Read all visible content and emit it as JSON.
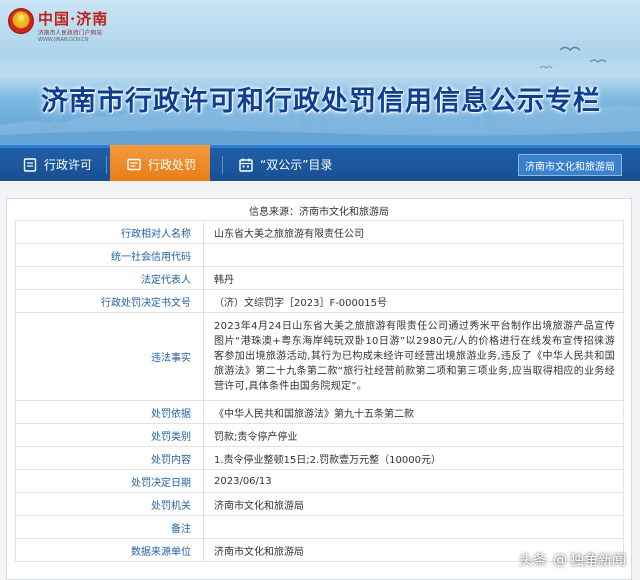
{
  "header": {
    "logo_text": "中国·济南",
    "logo_subtitle": "济南市人民政府门户网站",
    "logo_url": "WWW.JINAN.GOV.CN",
    "banner_title": "济南市行政许可和行政处罚信用信息公示专栏"
  },
  "nav": {
    "items": [
      {
        "label": "行政许可",
        "icon": "document-icon",
        "active": false
      },
      {
        "label": "行政处罚",
        "icon": "gavel-icon",
        "active": true
      },
      {
        "label": "“双公示”目录",
        "icon": "calendar-icon",
        "active": false
      }
    ],
    "department_button": "济南市文化和旅游局",
    "colors": {
      "bar": "#1a4f92",
      "active": "#e67b16"
    }
  },
  "record": {
    "source_line": "信息来源：济南市文化和旅游局",
    "rows": [
      {
        "label": "行政相对人名称",
        "value": "山东省大美之旅旅游有限责任公司"
      },
      {
        "label": "统一社会信用代码",
        "value": ""
      },
      {
        "label": "法定代表人",
        "value": "韩丹"
      },
      {
        "label": "行政处罚决定书文号",
        "value": "（济）文综罚字［2023］F-000015号"
      },
      {
        "label": "违法事实",
        "value": "2023年4月24日山东省大美之旅旅游有限责任公司通过秀米平台制作出境旅游产品宣传图片“港珠澳+粤东海岸纯玩双卧10日游”以2980元/人的价格进行在线发布宣传招徕游客参加出境旅游活动,其行为已构成未经许可经营出境旅游业务,违反了《中华人民共和国旅游法》第二十九条第二款“旅行社经营前款第二项和第三项业务,应当取得相应的业务经营许可,具体条件由国务院规定”。"
      },
      {
        "label": "处罚依据",
        "value": "《中华人民共和国旅游法》第九十五条第二款"
      },
      {
        "label": "处罚类别",
        "value": "罚款;责令停产停业"
      },
      {
        "label": "处罚内容",
        "value": "1.责令停业整顿15日;2.罚款壹万元整（10000元）"
      },
      {
        "label": "处罚决定日期",
        "value": "2023/06/13"
      },
      {
        "label": "处罚机关",
        "value": "济南市文化和旅游局"
      },
      {
        "label": "备注",
        "value": ""
      },
      {
        "label": "数据来源单位",
        "value": "济南市文化和旅游局"
      }
    ],
    "colors": {
      "label": "#2162a8",
      "value": "#333333"
    }
  },
  "watermark": {
    "platform": "头条",
    "account": "独角新闻"
  }
}
